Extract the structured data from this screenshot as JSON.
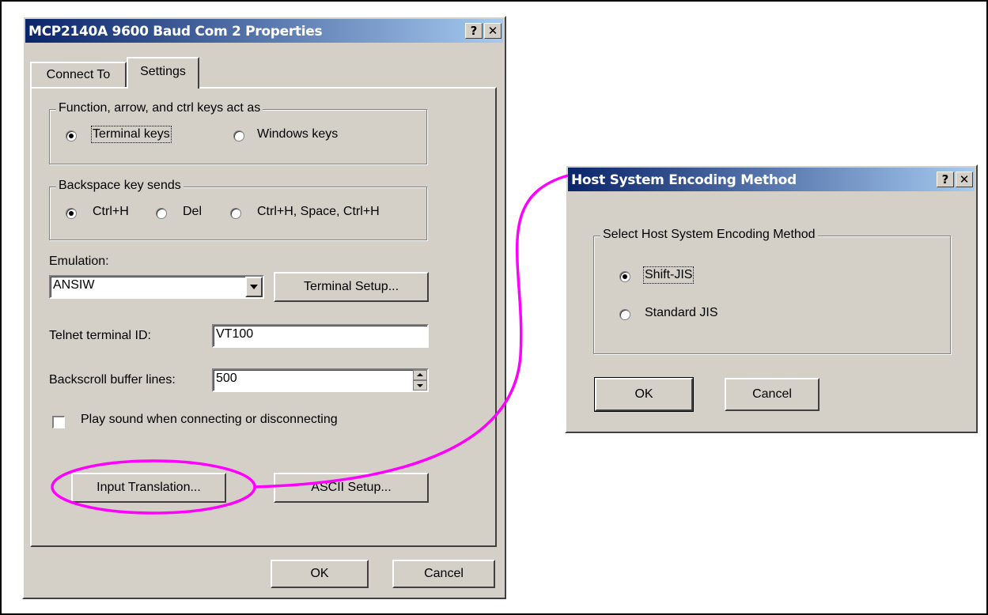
{
  "dialog1": {
    "title": "MCP2140A 9600 Baud Com 2 Properties",
    "help_btn": "?",
    "close_btn": "✕",
    "tabs": [
      "Connect To",
      "Settings"
    ],
    "keys_group": {
      "label": "Function, arrow, and ctrl keys act as",
      "options": [
        "Terminal keys",
        "Windows keys"
      ],
      "selected": "Terminal keys"
    },
    "backspace_group": {
      "label": "Backspace key sends",
      "options": [
        "Ctrl+H",
        "Del",
        "Ctrl+H, Space, Ctrl+H"
      ],
      "selected": "Ctrl+H"
    },
    "emulation_label": "Emulation:",
    "emulation_value": "ANSIW",
    "terminal_setup": "Terminal Setup...",
    "telnet_label": "Telnet terminal ID:",
    "telnet_value": "VT100",
    "backscroll_label": "Backscroll buffer lines:",
    "backscroll_value": "500",
    "play_sound_label": "Play sound when connecting or disconnecting",
    "play_sound_checked": false,
    "input_translation": "Input Translation...",
    "ascii_setup": "ASCII Setup...",
    "ok": "OK",
    "cancel": "Cancel"
  },
  "dialog2": {
    "title": "Host System Encoding Method",
    "help_btn": "?",
    "close_btn": "✕",
    "group_label": "Select Host System Encoding Method",
    "options": [
      "Shift-JIS",
      "Standard JIS"
    ],
    "selected": "Shift-JIS",
    "ok": "OK",
    "cancel": "Cancel"
  },
  "annotation": {
    "color": "#ff00ff"
  }
}
